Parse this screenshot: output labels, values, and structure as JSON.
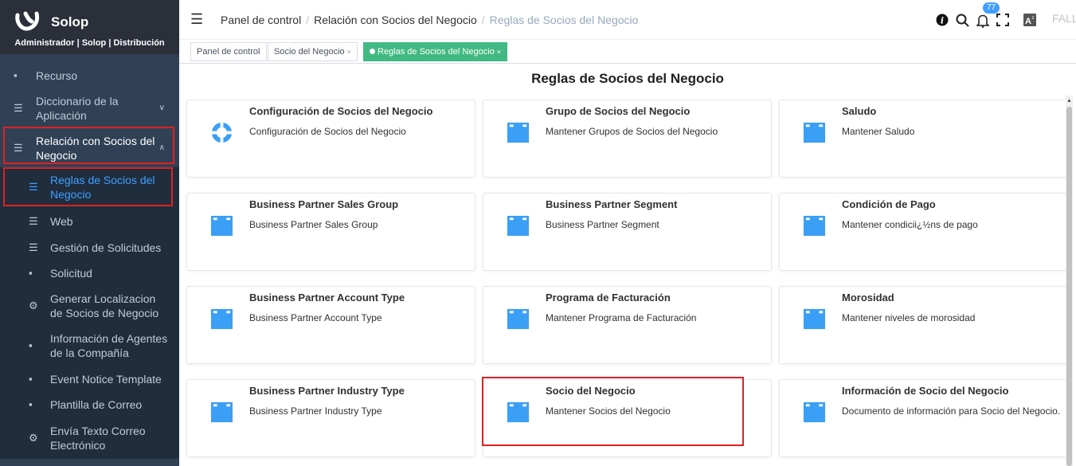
{
  "app": {
    "title": "Solop",
    "subtitle": "Administrador | Solop | Distribución"
  },
  "sidebar": {
    "items": [
      {
        "label": "Recurso",
        "icon": "folder-icon"
      },
      {
        "label": "Diccionario de la Aplicación",
        "icon": "list-icon",
        "chevron": "∨"
      },
      {
        "label": "Relación con Socios del Negocio",
        "icon": "list-icon",
        "chevron": "∧"
      },
      {
        "label": "Reglas de Socios del Negocio",
        "icon": "list-icon"
      },
      {
        "label": "Web",
        "icon": "list-icon"
      },
      {
        "label": "Gestión de Solicitudes",
        "icon": "list-icon"
      },
      {
        "label": "Solicitud",
        "icon": "folder-icon"
      },
      {
        "label": "Generar Localizacion de Socios de Negocio",
        "icon": "gear-icon"
      },
      {
        "label": "Información de Agentes de la Compañía",
        "icon": "folder-icon"
      },
      {
        "label": "Event Notice Template",
        "icon": "folder-icon"
      },
      {
        "label": "Plantilla de Correo",
        "icon": "folder-icon"
      },
      {
        "label": "Envía Texto Correo Electrónico",
        "icon": "gear-icon"
      }
    ]
  },
  "navbar": {
    "breadcrumb": [
      "Panel de control",
      "Relación con Socios del Negocio",
      "Reglas de Socios del Negocio"
    ],
    "notification_count": "77",
    "user_initials": "FALL"
  },
  "tags": [
    {
      "label": "Panel de control"
    },
    {
      "label": "Socio del Negocio",
      "close": "×"
    },
    {
      "label": "Reglas de Socios del Negocio",
      "close": "×"
    }
  ],
  "main": {
    "title": "Reglas de Socios del Negocio",
    "cards": [
      {
        "name": "Configuración de Socios del Negocio",
        "desc": "Configuración de Socios del Negocio",
        "icon": "settings-cog-icon"
      },
      {
        "name": "Grupo de Socios del Negocio",
        "desc": "Mantener Grupos de Socios del Negocio",
        "icon": "window-icon"
      },
      {
        "name": "Saludo",
        "desc": "Mantener Saludo",
        "icon": "window-icon"
      },
      {
        "name": "Business Partner Sales Group",
        "desc": "Business Partner Sales Group",
        "icon": "window-icon"
      },
      {
        "name": "Business Partner Segment",
        "desc": "Business Partner Segment",
        "icon": "window-icon"
      },
      {
        "name": "Condición de Pago",
        "desc": "Mantener condicii¿½ns de pago",
        "icon": "window-icon"
      },
      {
        "name": "Business Partner Account Type",
        "desc": "Business Partner Account Type",
        "icon": "window-icon"
      },
      {
        "name": "Programa de Facturación",
        "desc": "Mantener Programa de Facturación",
        "icon": "window-icon"
      },
      {
        "name": "Morosidad",
        "desc": "Mantener niveles de morosidad",
        "icon": "window-icon"
      },
      {
        "name": "Business Partner Industry Type",
        "desc": "Business Partner Industry Type",
        "icon": "window-icon"
      },
      {
        "name": "Socio del Negocio",
        "desc": "Mantener Socios del Negocio",
        "icon": "window-icon"
      },
      {
        "name": "Información de Socio del Negocio",
        "desc": "Documento de información para Socio del Negocio.",
        "icon": "window-icon"
      }
    ]
  },
  "colors": {
    "sidebar_bg": "#304156",
    "submenu_bg": "#1f2d3d",
    "accent": "#409eff",
    "active_tag": "#42b983",
    "highlight_box": "#e02020",
    "window_icon": "#3a9ff5"
  }
}
